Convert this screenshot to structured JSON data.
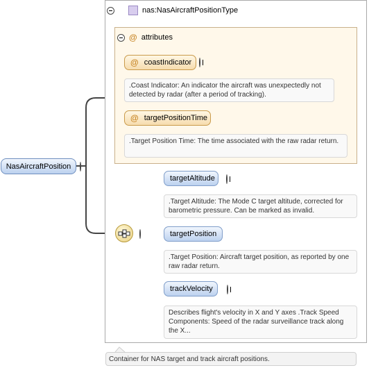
{
  "type_name": "nas:NasAircraftPositionType",
  "attributes": {
    "header": "attributes",
    "at_symbol": "@",
    "items": [
      {
        "name": "coastIndicator",
        "description": ".Coast Indicator: An indicator the aircraft was unexpectedly not detected by radar (after a period of tracking)."
      },
      {
        "name": "targetPositionTime",
        "description": ".Target Position Time: The time associated with the raw radar return."
      }
    ]
  },
  "root_element": {
    "name": "NasAircraftPosition",
    "description": "Container for NAS target and track aircraft positions."
  },
  "elements": [
    {
      "name": "targetAltitude",
      "description": ".Target Altitude: The Mode C target altitude, corrected for barometric pressure. Can be marked as invalid."
    },
    {
      "name": "targetPosition",
      "description": ".Target Position: Aircraft target position, as reported by one raw radar return."
    },
    {
      "name": "trackVelocity",
      "description": "Describes flight's velocity in X and Y axes .Track Speed Components: Speed of the radar surveillance track along the X..."
    }
  ],
  "colors": {
    "element_fill": "#bcd1ef",
    "attribute_fill": "#f6dcae",
    "attribute_group_bg": "#fff8ea",
    "type_icon": "#d8cdee"
  }
}
